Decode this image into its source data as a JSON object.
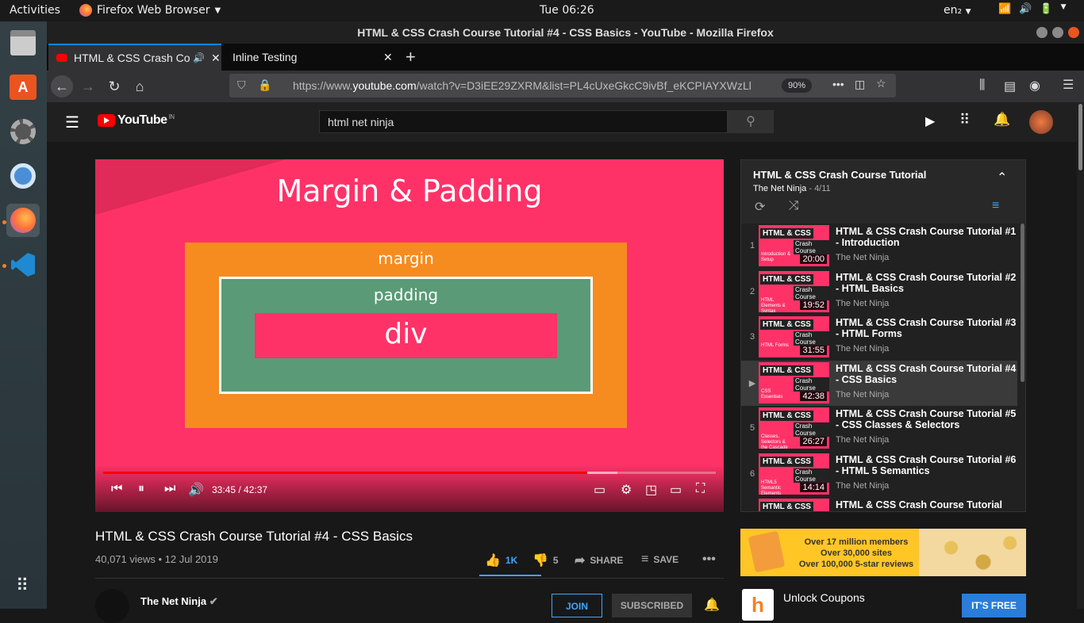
{
  "system": {
    "activities": "Activities",
    "app_name": "Firefox Web Browser",
    "clock": "Tue 06:26",
    "lang": "en₂"
  },
  "window": {
    "title": "HTML & CSS Crash Course Tutorial #4 - CSS Basics - YouTube - Mozilla Firefox"
  },
  "tabs": [
    {
      "label": "HTML & CSS Crash Co"
    },
    {
      "label": "Inline Testing"
    }
  ],
  "navbar": {
    "url_prefix": "https://www.",
    "url_domain": "youtube.com",
    "url_rest": "/watch?v=D3iEE29ZXRM&list=PL4cUxeGkcC9ivBf_eKCPIAYXWzLl",
    "zoom": "90%"
  },
  "youtube": {
    "logo_text": "YouTube",
    "logo_region": "IN",
    "search_value": "html net ninja",
    "player": {
      "slide_title": "Margin & Padding",
      "label_margin": "margin",
      "label_padding": "padding",
      "label_div": "div",
      "time": "33:45 / 42:37",
      "progress": 0.79,
      "buffered": 0.84
    },
    "video": {
      "title": "HTML & CSS Crash Course Tutorial #4 - CSS Basics",
      "meta": "40,071 views • 12 Jul 2019",
      "likes": "1K",
      "dislikes": "5",
      "share": "SHARE",
      "save": "SAVE",
      "channel": "The Net Ninja",
      "join": "JOIN",
      "subscribed": "SUBSCRIBED"
    },
    "playlist": {
      "title": "HTML & CSS Crash Course Tutorial",
      "channel": "The Net Ninja",
      "position": "4/11",
      "items": [
        {
          "idx": "1",
          "title": "HTML & CSS Crash Course Tutorial #1 - Introduction",
          "channel": "The Net Ninja",
          "duration": "20:00",
          "thumb_badge": "HTML & CSS",
          "thumb_sub": "Crash Course",
          "thumb_topic": "Introduction & Setup"
        },
        {
          "idx": "2",
          "title": "HTML & CSS Crash Course Tutorial #2 - HTML Basics",
          "channel": "The Net Ninja",
          "duration": "19:52",
          "thumb_badge": "HTML & CSS",
          "thumb_sub": "Crash Course",
          "thumb_topic": "HTML Elements & Syntax"
        },
        {
          "idx": "3",
          "title": "HTML & CSS Crash Course Tutorial #3 - HTML Forms",
          "channel": "The Net Ninja",
          "duration": "31:55",
          "thumb_badge": "HTML & CSS",
          "thumb_sub": "Crash Course",
          "thumb_topic": "HTML Forms"
        },
        {
          "idx": "▶",
          "title": "HTML & CSS Crash Course Tutorial #4 - CSS Basics",
          "channel": "The Net Ninja",
          "duration": "42:38",
          "thumb_badge": "HTML & CSS",
          "thumb_sub": "Crash Course",
          "thumb_topic": "CSS Essentials"
        },
        {
          "idx": "5",
          "title": "HTML & CSS Crash Course Tutorial #5 - CSS Classes & Selectors",
          "channel": "The Net Ninja",
          "duration": "26:27",
          "thumb_badge": "HTML & CSS",
          "thumb_sub": "Crash Course",
          "thumb_topic": "Classes, Selectors & the Cascade"
        },
        {
          "idx": "6",
          "title": "HTML & CSS Crash Course Tutorial #6 - HTML 5 Semantics",
          "channel": "The Net Ninja",
          "duration": "14:14",
          "thumb_badge": "HTML & CSS",
          "thumb_sub": "Crash Course",
          "thumb_topic": "HTML5 Semantic Elements"
        },
        {
          "idx": "",
          "title": "HTML & CSS Crash Course Tutorial",
          "channel": "",
          "duration": "",
          "thumb_badge": "HTML & CSS",
          "thumb_sub": "",
          "thumb_topic": ""
        }
      ]
    },
    "ad": {
      "line1": "Over 17 million members",
      "line2": "Over 30,000 sites",
      "line3": "Over 100,000 5-star reviews",
      "unlock": "Unlock Coupons",
      "cta": "IT'S FREE"
    }
  },
  "colors": {
    "accent_blue": "#0a84ff",
    "youtube_red": "#ff0000",
    "slide_pink": "#ff3268",
    "slide_orange": "#f68c1f",
    "slide_green": "#5a9a77"
  }
}
